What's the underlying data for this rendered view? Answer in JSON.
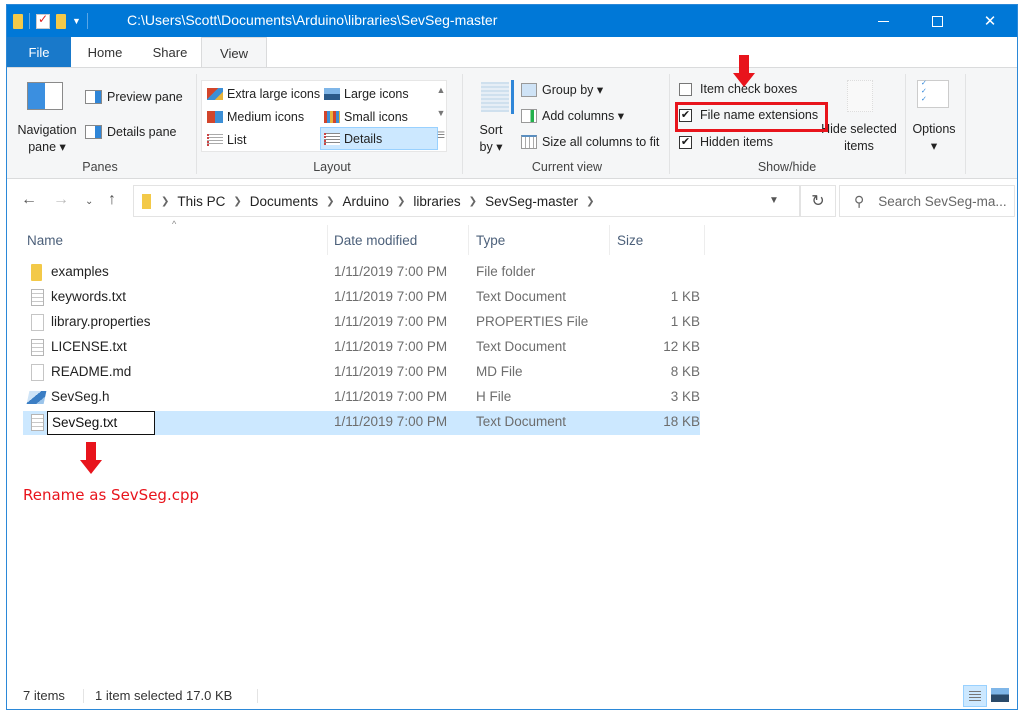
{
  "window": {
    "title_path": "C:\\Users\\Scott\\Documents\\Arduino\\libraries\\SevSeg-master",
    "controls": {
      "minimize": "minimize",
      "maximize": "maximize",
      "close": "✕"
    }
  },
  "ribbon_tabs": [
    {
      "label": "File",
      "active": false
    },
    {
      "label": "Home",
      "active": false
    },
    {
      "label": "Share",
      "active": false
    },
    {
      "label": "View",
      "active": true
    }
  ],
  "ribbon_extras": {
    "collapse_glyph": "^",
    "help_glyph": "?"
  },
  "ribbon": {
    "panes": {
      "label": "Panes",
      "navigation_pane": "Navigation pane",
      "navigation_pane_line1": "Navigation",
      "navigation_pane_line2": "pane ▾",
      "preview_pane": "Preview pane",
      "details_pane": "Details pane"
    },
    "layout": {
      "label": "Layout",
      "options": [
        {
          "label": "Extra large icons",
          "selected": false
        },
        {
          "label": "Large icons",
          "selected": false
        },
        {
          "label": "Medium icons",
          "selected": false
        },
        {
          "label": "Small icons",
          "selected": false
        },
        {
          "label": "List",
          "selected": false
        },
        {
          "label": "Details",
          "selected": true
        }
      ]
    },
    "current_view": {
      "label": "Current view",
      "sort_by_line1": "Sort",
      "sort_by_line2": "by ▾",
      "group_by": "Group by ▾",
      "add_columns": "Add columns ▾",
      "size_columns": "Size all columns to fit"
    },
    "show_hide": {
      "label": "Show/hide",
      "item_check_boxes": {
        "label": "Item check boxes",
        "checked": false
      },
      "file_name_extensions": {
        "label": "File name extensions",
        "checked": true
      },
      "hidden_items": {
        "label": "Hidden items",
        "checked": true
      },
      "hide_selected_line1": "Hide selected",
      "hide_selected_line2": "items"
    },
    "options": {
      "line1": "Options",
      "line2": "▾"
    }
  },
  "address_bar": {
    "breadcrumbs": [
      "This PC",
      "Documents",
      "Arduino",
      "libraries",
      "SevSeg-master"
    ],
    "search_placeholder": "Search SevSeg-ma..."
  },
  "file_list": {
    "columns": [
      "Name",
      "Date modified",
      "Type",
      "Size"
    ],
    "rows": [
      {
        "name": "examples",
        "date": "1/11/2019 7:00 PM",
        "type": "File folder",
        "size": "",
        "icon": "folder-icon"
      },
      {
        "name": "keywords.txt",
        "date": "1/11/2019 7:00 PM",
        "type": "Text Document",
        "size": "1 KB",
        "icon": "text-file-icon"
      },
      {
        "name": "library.properties",
        "date": "1/11/2019 7:00 PM",
        "type": "PROPERTIES File",
        "size": "1 KB",
        "icon": "blank-file-icon"
      },
      {
        "name": "LICENSE.txt",
        "date": "1/11/2019 7:00 PM",
        "type": "Text Document",
        "size": "12 KB",
        "icon": "text-file-icon"
      },
      {
        "name": "README.md",
        "date": "1/11/2019 7:00 PM",
        "type": "MD File",
        "size": "8 KB",
        "icon": "blank-file-icon"
      },
      {
        "name": "SevSeg.h",
        "date": "1/11/2019 7:00 PM",
        "type": "H File",
        "size": "3 KB",
        "icon": "h-file-icon"
      },
      {
        "name": "SevSeg.txt",
        "date": "1/11/2019 7:00 PM",
        "type": "Text Document",
        "size": "18 KB",
        "icon": "text-file-icon",
        "selected": true,
        "renaming": true
      }
    ]
  },
  "annotation": {
    "instruction": "Rename as SevSeg.cpp",
    "color": "#e8141c"
  },
  "status_bar": {
    "item_count": "7 items",
    "selection": "1 item selected  17.0 KB"
  },
  "colors": {
    "titlebar": "#0078d7",
    "file_tab": "#1979ca",
    "selection": "#cce8ff"
  }
}
